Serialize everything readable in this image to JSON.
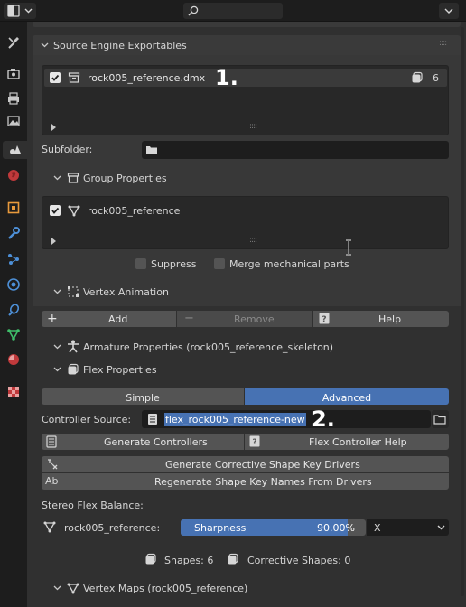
{
  "header": {
    "editor_type_icon": "properties-editor-icon",
    "search_placeholder": "",
    "search_icon": "search-icon",
    "options_icon": "chevron-down-icon"
  },
  "tabs": [
    {
      "name": "tool-tab",
      "icon": "wrench-screwdriver-icon"
    },
    {
      "name": "render-tab",
      "icon": "camera-back-icon"
    },
    {
      "name": "output-tab",
      "icon": "printer-icon"
    },
    {
      "name": "view-layer-tab",
      "icon": "image-icon"
    },
    {
      "name": "scene-tab",
      "icon": "scene-cone-sphere-icon"
    },
    {
      "name": "world-tab",
      "icon": "world-globe-icon"
    },
    {
      "name": "object-tab",
      "icon": "object-square-icon"
    },
    {
      "name": "modifiers-tab",
      "icon": "wrench-icon"
    },
    {
      "name": "particles-tab",
      "icon": "particles-icon"
    },
    {
      "name": "physics-tab",
      "icon": "physics-circle-icon"
    },
    {
      "name": "constraints-tab",
      "icon": "constraint-icon"
    },
    {
      "name": "data-tab",
      "icon": "mesh-data-triangle-icon"
    },
    {
      "name": "material-tab",
      "icon": "material-sphere-icon"
    },
    {
      "name": "texture-tab",
      "icon": "checker-texture-icon"
    }
  ],
  "exportables": {
    "title": "Source Engine Exportables",
    "items": [
      {
        "label": "rock005_reference.dmx",
        "count": "6"
      }
    ]
  },
  "subfolder": {
    "label": "Subfolder:",
    "value": ""
  },
  "group_properties": {
    "title": "Group Properties",
    "items": [
      {
        "label": "rock005_reference"
      }
    ],
    "suppress_label": "Suppress",
    "merge_label": "Merge mechanical parts"
  },
  "vertex_animation": {
    "title": "Vertex Animation",
    "add_label": "Add",
    "remove_label": "Remove",
    "help_label": "Help"
  },
  "armature_properties": {
    "title": "Armature Properties (rock005_reference_skeleton)"
  },
  "flex_properties": {
    "title": "Flex Properties",
    "mode_simple": "Simple",
    "mode_advanced": "Advanced",
    "mode_selected": "Advanced",
    "controller_source_label": "Controller Source:",
    "controller_source_value": "flex_rock005_reference-new",
    "generate_controllers_label": "Generate Controllers",
    "flex_help_label": "Flex Controller Help",
    "generate_drivers_label": "Generate Corrective Shape Key Drivers",
    "regenerate_names_label": "Regenerate Shape Key Names From Drivers",
    "stereo_label": "Stereo Flex Balance:",
    "stereo_object": "rock005_reference:",
    "sharpness_label": "Sharpness",
    "sharpness_value": "90.00%",
    "sharpness_fraction": 0.9,
    "axis_value": "X",
    "shapes_label": "Shapes: 6",
    "corrective_label": "Corrective Shapes: 0"
  },
  "vertex_maps": {
    "title": "Vertex Maps (rock005_reference)"
  },
  "annotations": {
    "one": "1.",
    "two": "2."
  },
  "colors": {
    "accent": "#4772b3",
    "background": "#303030",
    "field": "#1d1d1d",
    "button": "#545454"
  }
}
